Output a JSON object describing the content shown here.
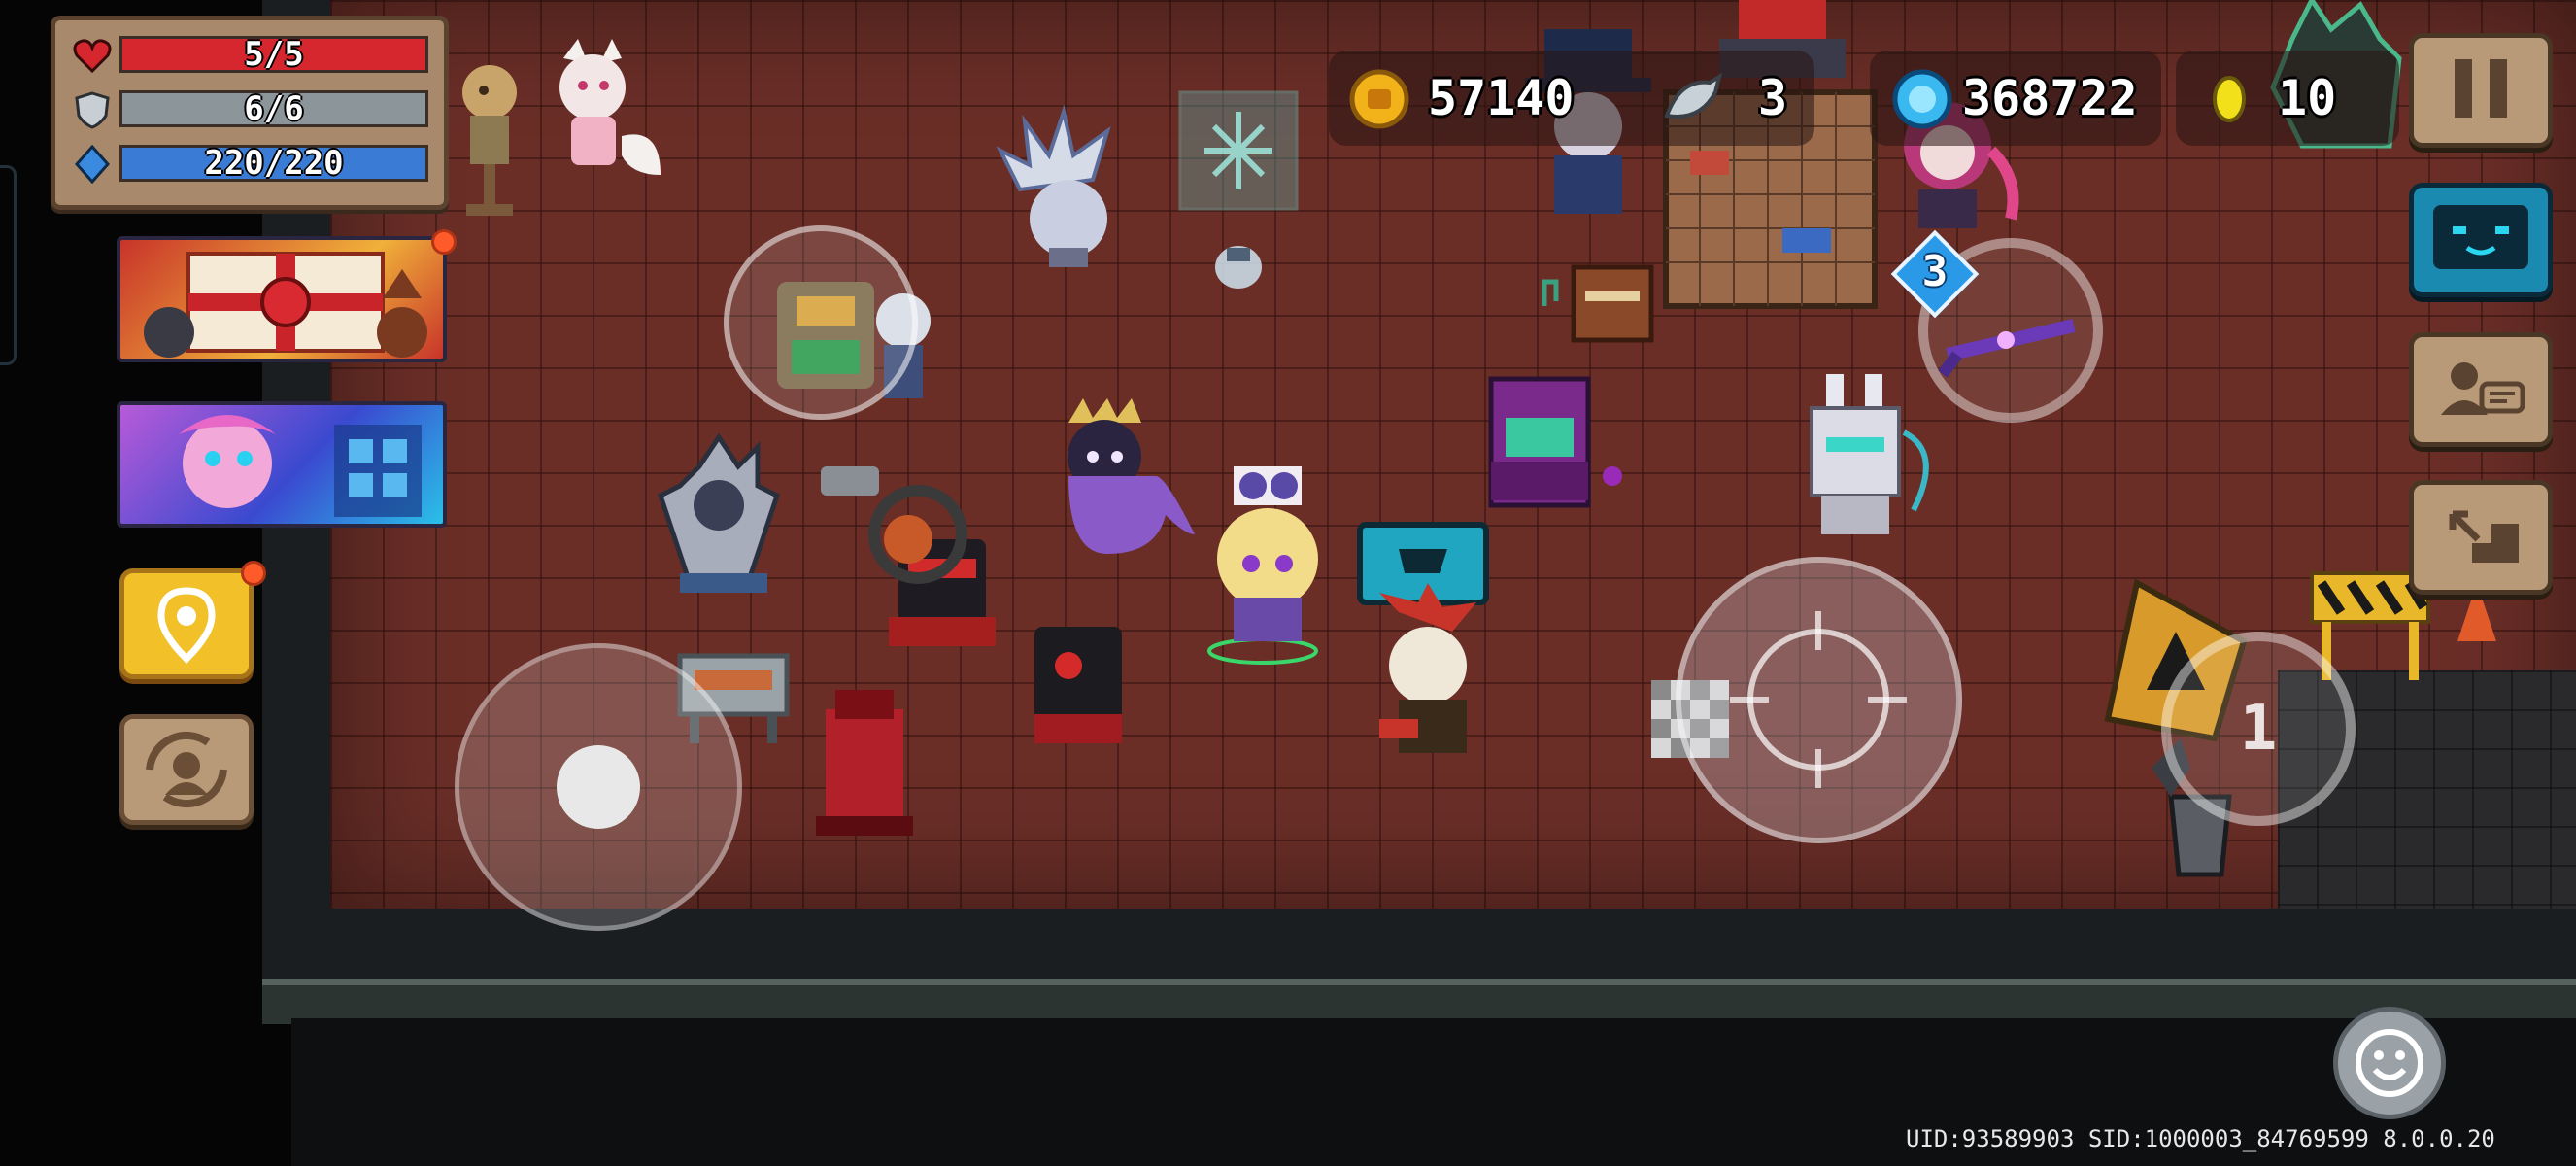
{
  "hud": {
    "hp": {
      "value": "5/5",
      "fraction": 1.0,
      "color": "#d6262e"
    },
    "armor": {
      "value": "6/6",
      "fraction": 1.0,
      "color": "#8c959a"
    },
    "energy": {
      "value": "220/220",
      "fraction": 1.0,
      "color": "#3a7bd5"
    }
  },
  "currency": {
    "gold": "57140",
    "fish": "3",
    "gems": "368722",
    "tokens": "10"
  },
  "left_menu": {
    "event_banner_badge": true,
    "skin_banner_badge": false,
    "location_badge": true
  },
  "skill_cooldown": {
    "charges": "3",
    "weapon_slot": "1"
  },
  "footer": {
    "uid_line": "UID:93589903 SID:1000003_84769599 8.0.0.20"
  },
  "icons": {
    "hp": "heart-icon",
    "armor": "shield-icon",
    "energy": "diamond-energy-icon",
    "gold": "gold-coin-icon",
    "fish": "fish-icon",
    "gems": "blue-gem-icon",
    "tokens": "yellow-token-icon",
    "pause": "pause-icon",
    "chat": "chat-face-icon",
    "profile": "profile-card-icon",
    "exit": "exit-stairs-icon",
    "location": "map-pin-icon",
    "swap": "swap-character-icon",
    "emote": "smiley-icon"
  }
}
